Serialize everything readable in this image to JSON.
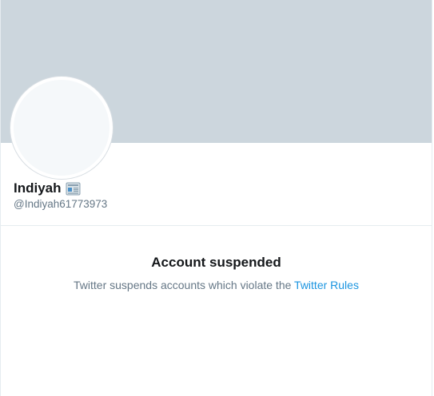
{
  "profile": {
    "display_name": "Indiyah",
    "name_emoji_icon": "newspaper-icon",
    "handle": "@Indiyah61773973"
  },
  "suspension": {
    "title": "Account suspended",
    "message": "Twitter suspends accounts which violate the",
    "link_text": "Twitter Rules"
  },
  "colors": {
    "banner": "#ccd6dd",
    "avatar_fill": "#f5f8fa",
    "primary_text": "#14171a",
    "secondary_text": "#657786",
    "link": "#1b95e0",
    "divider": "#e6ecf0"
  }
}
